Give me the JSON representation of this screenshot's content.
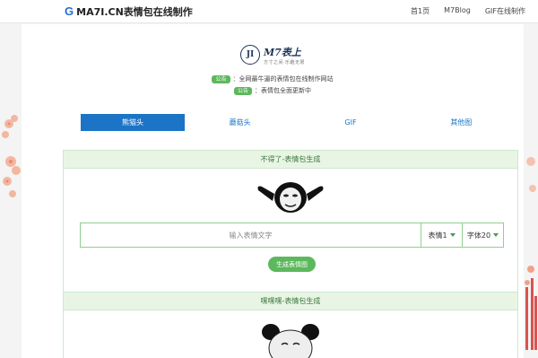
{
  "header": {
    "brand_letter": "G",
    "brand_text": "MA7I.CN表情包在线制作",
    "nav": [
      "首1页",
      "M7Blog",
      "GIF在线制作"
    ]
  },
  "logo": {
    "mark": "JI",
    "title": "M7表上",
    "subtitle": "方寸之间·乐趣无限"
  },
  "notices": [
    {
      "badge": "公告",
      "text": "：全网最牛逼的表情包在线制作网站"
    },
    {
      "badge": "公告",
      "text": "：表情包全面更新中"
    }
  ],
  "tabs": [
    "熊猫头",
    "蘑菇头",
    "GIF",
    "其他图"
  ],
  "generator": {
    "title": "不得了-表情包生成",
    "input_placeholder": "输入表情文字",
    "select_face": "表情1",
    "select_font": "字体20",
    "button": "生成表情图"
  },
  "second_panel": {
    "title": "嘿嘿嘿-表情包生成"
  },
  "colors": {
    "accent": "#5cb85c",
    "tab_active": "#1b74c6",
    "brand": "#1f6fd6"
  }
}
